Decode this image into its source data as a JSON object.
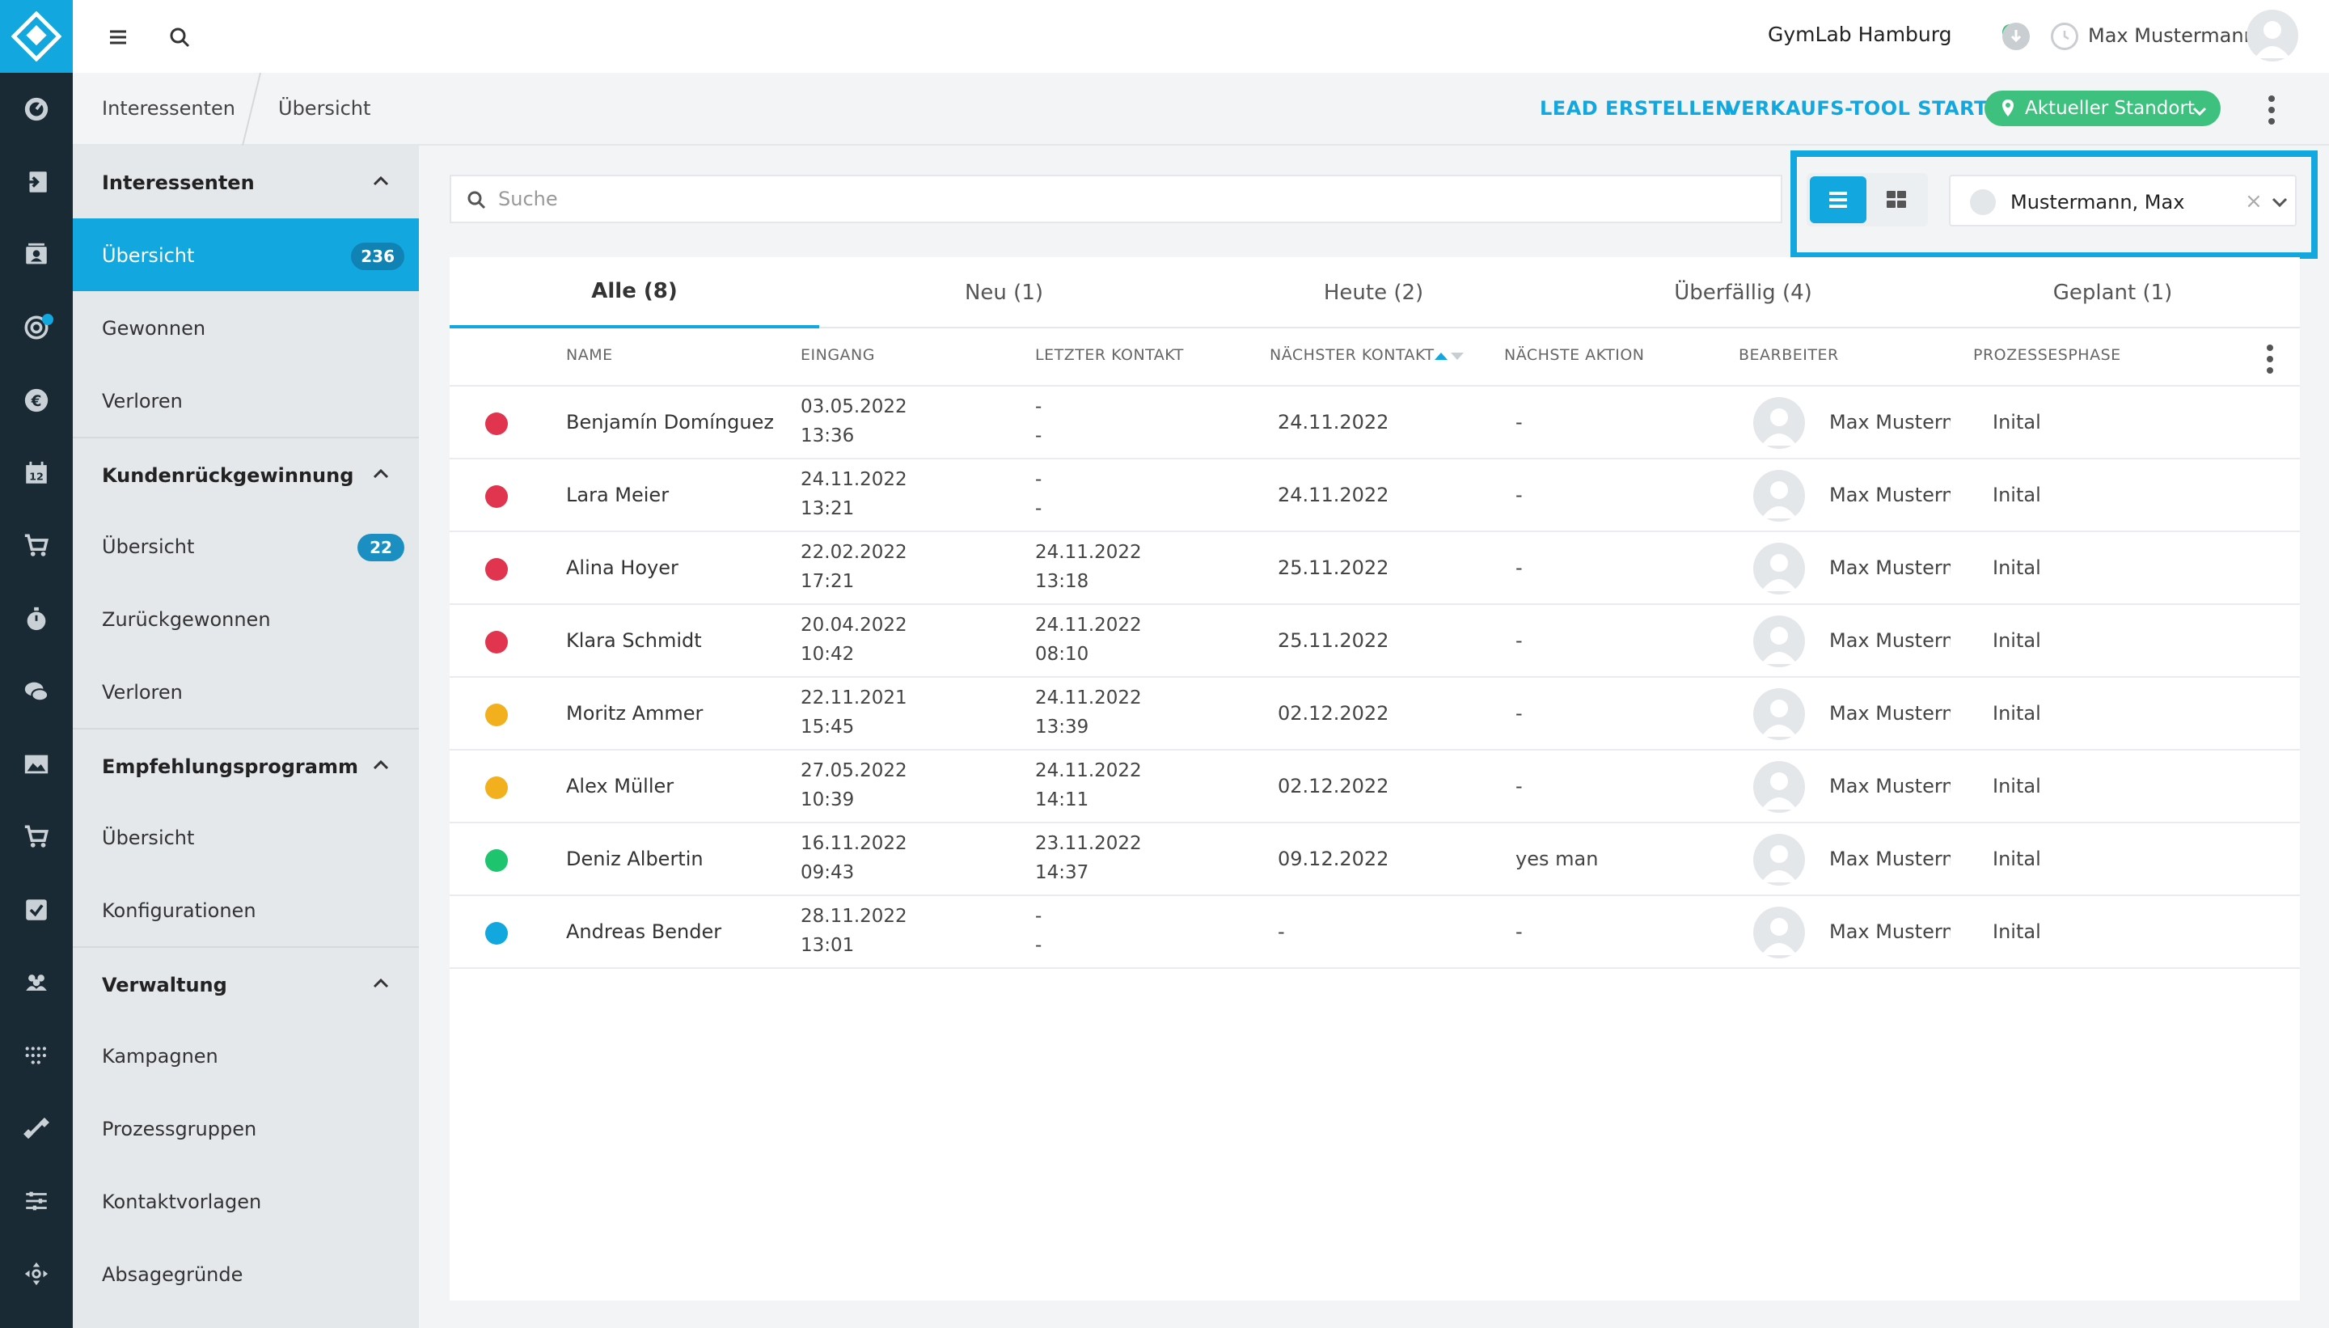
{
  "topbar": {
    "location": "GymLab Hamburg",
    "user": "Max Mustermann"
  },
  "breadcrumb": {
    "level1": "Interessenten",
    "level2": "Übersicht"
  },
  "actions": {
    "create_lead": "LEAD ERSTELLEN",
    "start_sales_tool": "VERKAUFS-TOOL STARTEN",
    "current_location": "Aktueller Standort"
  },
  "sidebar": {
    "groups": [
      {
        "title": "Interessenten",
        "items": [
          {
            "label": "Übersicht",
            "badge": "236"
          },
          {
            "label": "Gewonnen"
          },
          {
            "label": "Verloren"
          }
        ]
      },
      {
        "title": "Kundenrückgewinnung",
        "items": [
          {
            "label": "Übersicht",
            "badge": "22"
          },
          {
            "label": "Zurückgewonnen"
          },
          {
            "label": "Verloren"
          }
        ]
      },
      {
        "title": "Empfehlungsprogramm",
        "items": [
          {
            "label": "Übersicht"
          },
          {
            "label": "Konfigurationen"
          }
        ]
      },
      {
        "title": "Verwaltung",
        "items": [
          {
            "label": "Kampagnen"
          },
          {
            "label": "Prozessgruppen"
          },
          {
            "label": "Kontaktvorlagen"
          },
          {
            "label": "Absagegründe"
          }
        ]
      }
    ]
  },
  "search": {
    "placeholder": "Suche",
    "value": ""
  },
  "filter": {
    "assignee": "Mustermann, Max",
    "clear": "×"
  },
  "tabs": [
    {
      "label": "Alle (8)"
    },
    {
      "label": "Neu (1)"
    },
    {
      "label": "Heute (2)"
    },
    {
      "label": "Überfällig (4)"
    },
    {
      "label": "Geplant (1)"
    }
  ],
  "table": {
    "headers": {
      "name": "NAME",
      "eingang": "EINGANG",
      "letzter_kontakt": "LETZTER KONTAKT",
      "naechster_kontakt": "NÄCHSTER KONTAKT",
      "naechste_aktion": "NÄCHSTE AKTION",
      "bearbeiter": "BEARBEITER",
      "prozessphase": "PROZESSESPHASE"
    },
    "rows": [
      {
        "status": "#e0344f",
        "name": "Benjamín Domínguez",
        "eingang_date": "03.05.2022",
        "eingang_time": "13:36",
        "letzter_date": "-",
        "letzter_time": "-",
        "naechster": "24.11.2022",
        "aktion": "-",
        "bearbeiter": "Max Mustermann",
        "phase": "Inital"
      },
      {
        "status": "#e0344f",
        "name": "Lara Meier",
        "eingang_date": "24.11.2022",
        "eingang_time": "13:21",
        "letzter_date": "-",
        "letzter_time": "-",
        "naechster": "24.11.2022",
        "aktion": "-",
        "bearbeiter": "Max Mustermann",
        "phase": "Inital"
      },
      {
        "status": "#e0344f",
        "name": "Alina Hoyer",
        "eingang_date": "22.02.2022",
        "eingang_time": "17:21",
        "letzter_date": "24.11.2022",
        "letzter_time": "13:18",
        "naechster": "25.11.2022",
        "aktion": "-",
        "bearbeiter": "Max Mustermann",
        "phase": "Inital"
      },
      {
        "status": "#e0344f",
        "name": "Klara Schmidt",
        "eingang_date": "20.04.2022",
        "eingang_time": "10:42",
        "letzter_date": "24.11.2022",
        "letzter_time": "08:10",
        "naechster": "25.11.2022",
        "aktion": "-",
        "bearbeiter": "Max Mustermann",
        "phase": "Inital"
      },
      {
        "status": "#f2b01e",
        "name": "Moritz Ammer",
        "eingang_date": "22.11.2021",
        "eingang_time": "15:45",
        "letzter_date": "24.11.2022",
        "letzter_time": "13:39",
        "naechster": "02.12.2022",
        "aktion": "-",
        "bearbeiter": "Max Mustermann",
        "phase": "Inital"
      },
      {
        "status": "#f2b01e",
        "name": "Alex Müller",
        "eingang_date": "27.05.2022",
        "eingang_time": "10:39",
        "letzter_date": "24.11.2022",
        "letzter_time": "14:11",
        "naechster": "02.12.2022",
        "aktion": "-",
        "bearbeiter": "Max Mustermann",
        "phase": "Inital"
      },
      {
        "status": "#1ec46e",
        "name": "Deniz Albertin",
        "eingang_date": "16.11.2022",
        "eingang_time": "09:43",
        "letzter_date": "23.11.2022",
        "letzter_time": "14:37",
        "naechster": "09.12.2022",
        "aktion": "yes man",
        "bearbeiter": "Max Mustermann",
        "phase": "Inital"
      },
      {
        "status": "#12a7de",
        "name": "Andreas Bender",
        "eingang_date": "28.11.2022",
        "eingang_time": "13:01",
        "letzter_date": "-",
        "letzter_time": "-",
        "naechster": "-",
        "aktion": "-",
        "bearbeiter": "Max Mustermann",
        "phase": "Inital"
      }
    ]
  },
  "colors": {
    "accent": "#12a7de",
    "rail": "#1a2a35",
    "success": "#3ec17e"
  },
  "icons": [
    "app-logo-icon",
    "dashboard-icon",
    "checkin-icon",
    "contacts-icon",
    "leads-icon",
    "euro-icon",
    "calendar-icon",
    "cart-icon",
    "timer-icon",
    "chat-icon",
    "image-icon",
    "shop-icon",
    "check-icon",
    "members-icon",
    "heatmap-icon",
    "dumbbell-icon",
    "sliders-icon",
    "move-icon"
  ]
}
